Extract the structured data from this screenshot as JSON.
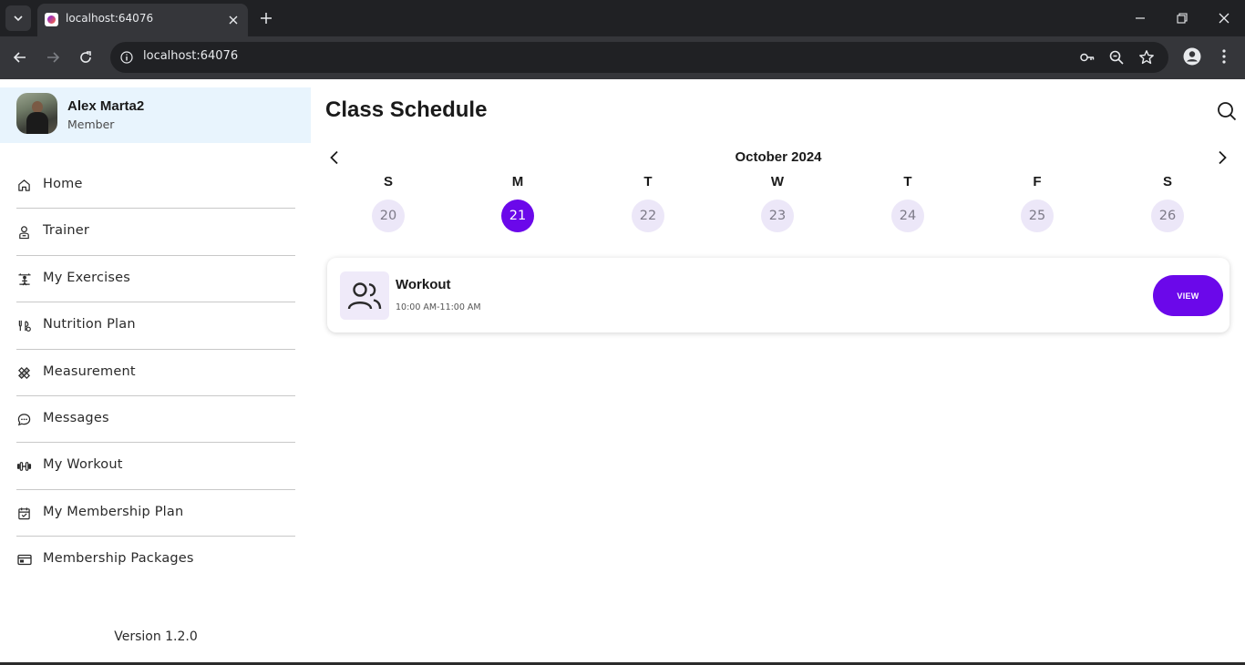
{
  "browser": {
    "tab_title": "localhost:64076",
    "url": "localhost:64076"
  },
  "profile": {
    "name": "Alex Marta2",
    "role": "Member"
  },
  "sidebar": {
    "items": [
      {
        "label": "Home",
        "icon": "home-icon"
      },
      {
        "label": "Trainer",
        "icon": "trainer-icon"
      },
      {
        "label": "My Exercises",
        "icon": "exercises-icon"
      },
      {
        "label": "Nutrition Plan",
        "icon": "nutrition-icon"
      },
      {
        "label": "Measurement",
        "icon": "measurement-icon"
      },
      {
        "label": "Messages",
        "icon": "messages-icon"
      },
      {
        "label": "My Workout",
        "icon": "dumbbell-icon"
      },
      {
        "label": "My Membership Plan",
        "icon": "calendar-icon"
      },
      {
        "label": "Membership Packages",
        "icon": "card-icon"
      }
    ],
    "version": "Version 1.2.0"
  },
  "main": {
    "title": "Class Schedule",
    "month": "October 2024",
    "days": [
      {
        "letter": "S",
        "number": "20"
      },
      {
        "letter": "M",
        "number": "21"
      },
      {
        "letter": "T",
        "number": "22"
      },
      {
        "letter": "W",
        "number": "23"
      },
      {
        "letter": "T",
        "number": "24"
      },
      {
        "letter": "F",
        "number": "25"
      },
      {
        "letter": "S",
        "number": "26"
      }
    ],
    "selected_day": "21",
    "classes": [
      {
        "name": "Workout",
        "time": "10:00 AM-11:00 AM",
        "action_label": "VIEW",
        "icon": "group-icon"
      }
    ]
  },
  "colors": {
    "accent": "#6b08ea",
    "profile_bg": "#e8f4fd",
    "day_bg": "#ece7f8"
  }
}
